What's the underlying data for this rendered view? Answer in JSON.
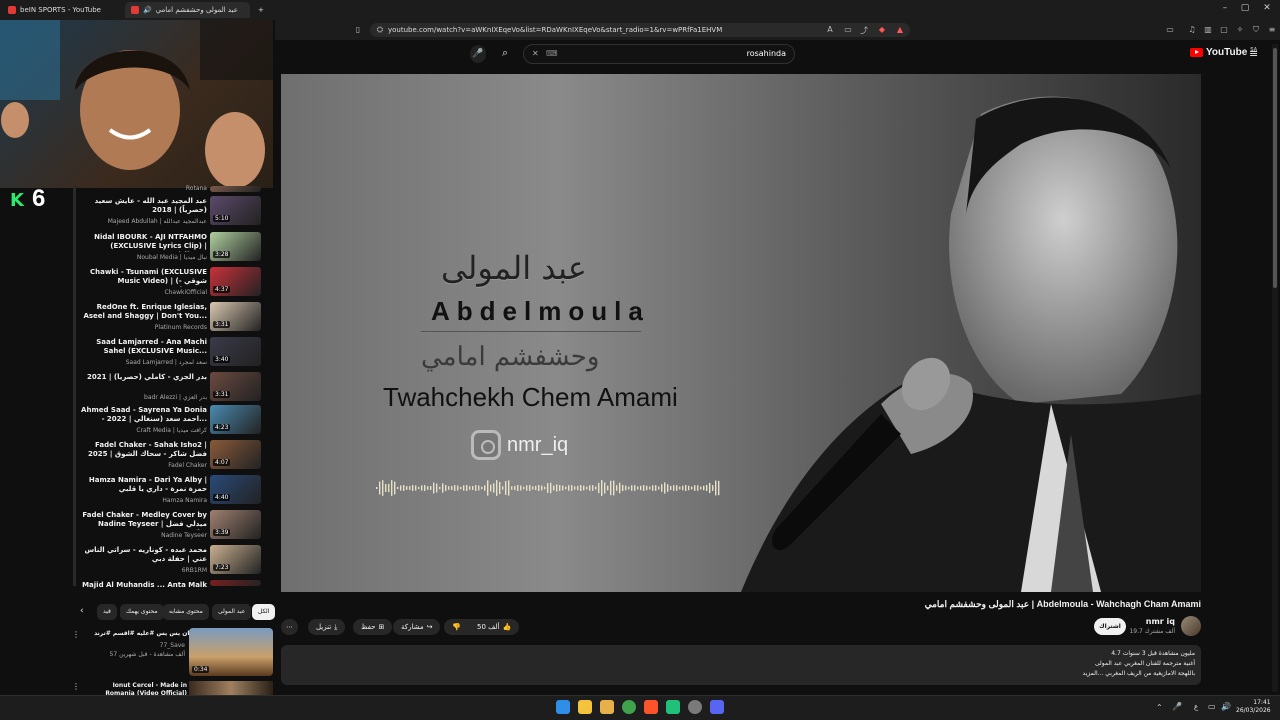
{
  "browser": {
    "tabs": [
      {
        "label": "beIN SPORTS - YouTube"
      },
      {
        "label": "عبد المولى وحشفشم امامي"
      }
    ],
    "url": "youtube.com/watch?v=aWKnIXEqeVo&list=RDaWKnIXEqeVo&start_radio=1&rv=wPRfFa1EHVM",
    "controls": {
      "min": "–",
      "max": "▢",
      "close": "✕"
    }
  },
  "header": {
    "search_value": "rosahinda",
    "search_clear": "✕",
    "logo": "YouTube",
    "logo_region": "SA"
  },
  "webcam": {
    "badge_k": "K",
    "badge_num": "6"
  },
  "video": {
    "overlay_ar": "عبد المولى",
    "overlay_en": "Abdelmoula",
    "overlay_ar2": "وحشفشم امامي",
    "overlay_en2": "Twahchekh Chem Amami",
    "overlay_ig": "nmr_iq",
    "title": "عبد المولى وحشفشم امامي | Abdelmoula - Wahchagh Cham Amami"
  },
  "channel": {
    "name": "nmr iq",
    "subs": "19.7 ألف مشترك",
    "subscribe_label": "اشتراك"
  },
  "actions": {
    "likes": "50 ألف",
    "share": "مشاركة",
    "save": "حفظ",
    "download": "تنزيل",
    "more": "⋯"
  },
  "description": {
    "line1": "4.7 مليون مشاهدة  قبل 3 سنوات",
    "line2": "أغنية مترجمة للفنان المغربي عبد المولى",
    "line3": "باللهجة الامازيغية من الريف المغربي ...المزيد"
  },
  "chips": [
    "الكل",
    "عبد المولى",
    "محتوى مشابه",
    "محتوى يهمك",
    "قيد"
  ],
  "playlist": [
    {
      "title": "Rotana",
      "channel": "",
      "duration": ""
    },
    {
      "title": "عبد المجيد عبد الله - عايش سعيد (حصرياً) | 2018",
      "channel": "Majeed Abdullah | عبدالمجيد عبدالله",
      "duration": "5:10"
    },
    {
      "title": "Nidal IBOURK - AJI NTFAHMO (EXCLUSIVE Lyrics Clip) | (نضال...",
      "channel": "Noubal Media | نبال ميديا",
      "duration": "3:28"
    },
    {
      "title": "Chawki - Tsunami (EXCLUSIVE Music Video) | (شوقي - تسونامي...",
      "channel": "ChawkiOfficial",
      "duration": "4:37"
    },
    {
      "title": "RedOne ft. Enrique Iglesias, Aseel and Shaggy | Don't You...",
      "channel": "Platinum Records",
      "duration": "3:31"
    },
    {
      "title": "Saad Lamjarred - Ana Machi Sahel (EXCLUSIVE Music...",
      "channel": "Saad Lamjarred | سعد لمجرد",
      "duration": "3:40"
    },
    {
      "title": "بدر الجزي - كاملي (حصرياً) | 2021",
      "channel": "badr Alezzi | بدر العزي",
      "duration": "3:31"
    },
    {
      "title": "Ahmed Saad - Sayrena Ya Donia - 2022 | احمد سعد (سنغالي...",
      "channel": "Craft Media | كرافت ميديا",
      "duration": "4:23"
    },
    {
      "title": "Fadel Chaker - Sahak Isho2 | 2025 | فضل شاكر - سحاك الشوق",
      "channel": "Fadel Chaker",
      "duration": "4:07"
    },
    {
      "title": "Hamza Namira - Dari Ya Alby | حمزة نمرة - داري يا قلبي",
      "channel": "Hamza Namira",
      "duration": "4:40"
    },
    {
      "title": "Fadel Chaker - Medley Cover by Nadine Teyseer | ميدلي فضل شاكر",
      "channel": "Nadine Teyseer",
      "duration": "3:39"
    },
    {
      "title": "محمد عبده - كوناريه - سراتي الناس عني | حفلة دبي",
      "channel": "6RB1RM",
      "duration": "7:23"
    },
    {
      "title": "Majid Al Muhandis ... Anta Malk",
      "channel": "",
      "duration": ""
    }
  ],
  "related": [
    {
      "title": "هذا هسعان يس يس #عليه #اقسم #ترند",
      "channel": "77_Save",
      "meta": "57 ألف مشاهدة - قبل شهرين",
      "duration": "0:34"
    },
    {
      "title": "Ionut Cercel - Made in Romania (Video Official)",
      "channel": "",
      "meta": "",
      "duration": ""
    }
  ],
  "taskbar": {
    "time": "17:41",
    "date": "26/03/2026",
    "lang": "ع"
  }
}
